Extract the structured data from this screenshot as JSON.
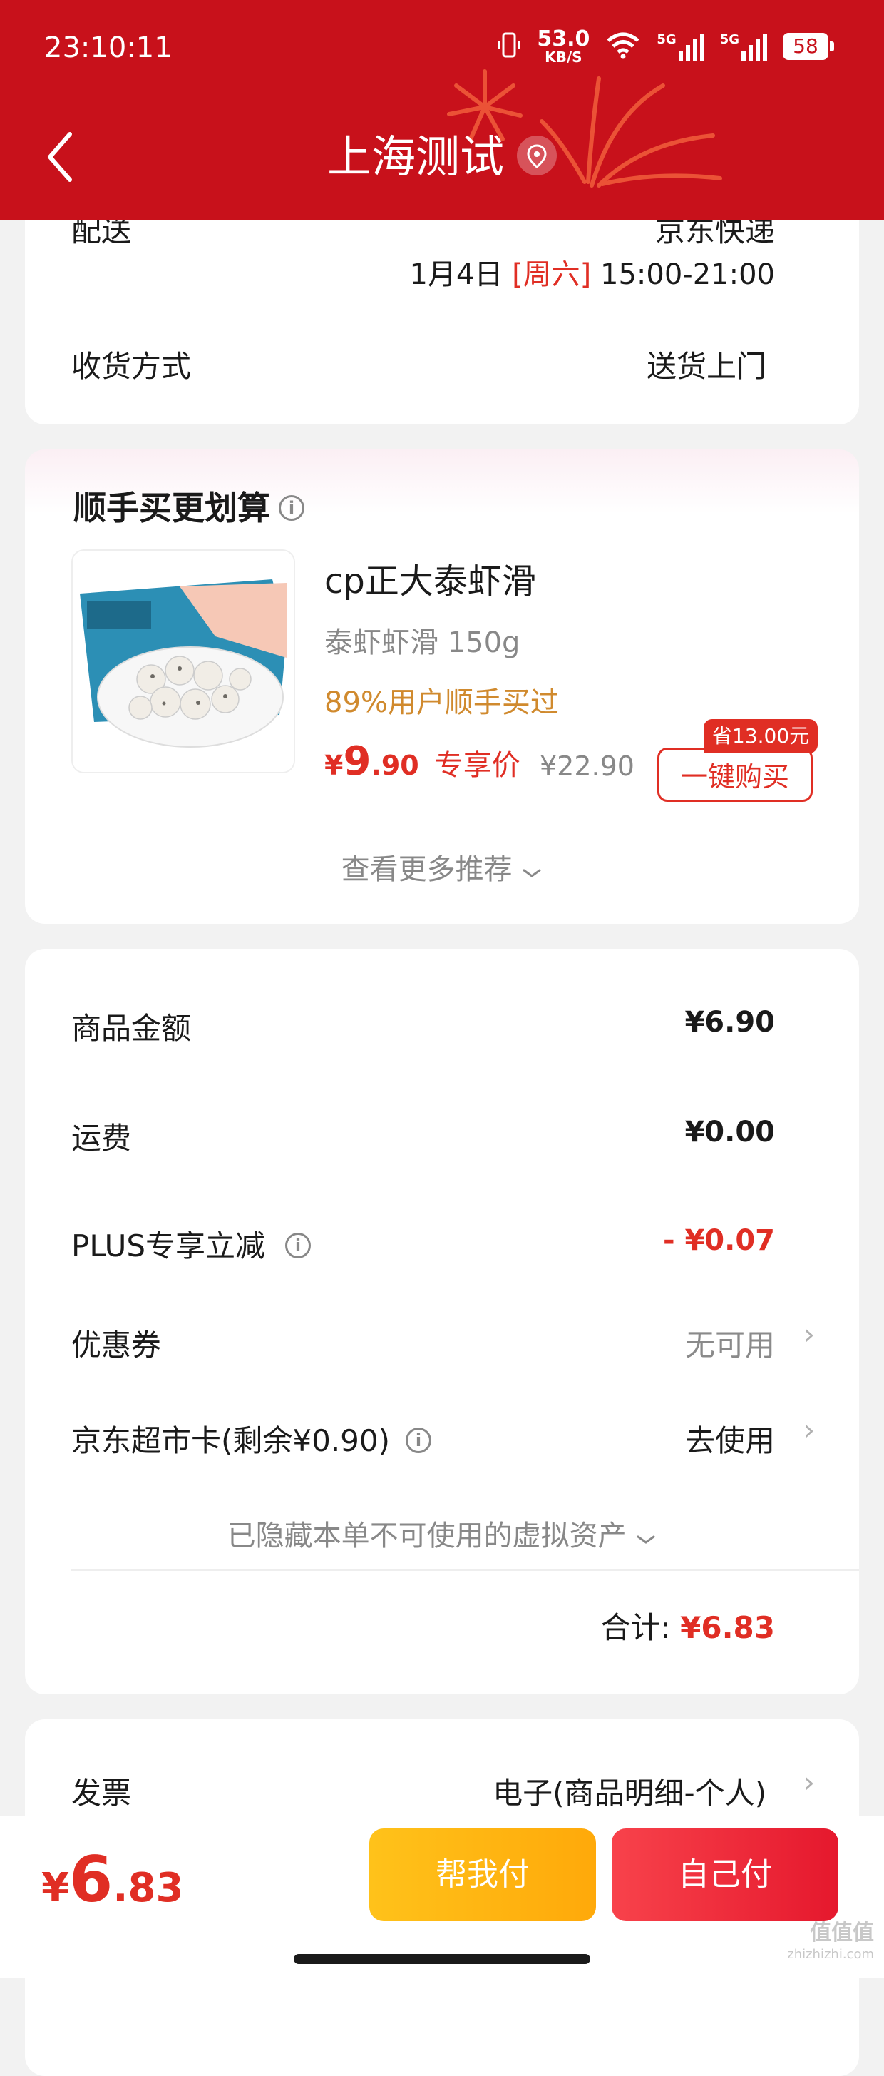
{
  "status_bar": {
    "time": "23:10:11",
    "net_speed_value": "53.0",
    "net_speed_unit": "KB/S",
    "signal_1": "5G",
    "signal_2": "5G",
    "battery": "58"
  },
  "header": {
    "title": "上海测试",
    "background_color": "#c8111b"
  },
  "delivery": {
    "label_partial": "配送",
    "value_partial": "京东快递",
    "date": "1月4日",
    "weekday": "[周六]",
    "time_slot": "15:00-21:00",
    "method_label": "收货方式",
    "method_value": "送货上门"
  },
  "recommend": {
    "title": "顺手买更划算",
    "product": {
      "name": "cp正大泰虾滑",
      "spec": "泰虾虾滑 150g",
      "tag": "89%用户顺手买过",
      "price_symbol": "¥",
      "price_int": "9",
      "price_dec": ".90",
      "price_label": "专享价",
      "original_price": "¥22.90",
      "save_badge": "省13.00元",
      "buy_button": "一键购买"
    },
    "more_label": "查看更多推荐"
  },
  "summary": {
    "rows": [
      {
        "label": "商品金额",
        "value": "¥6.90"
      },
      {
        "label": "运费",
        "value": "¥0.00"
      },
      {
        "label": "PLUS专享立减",
        "value": "- ¥0.07"
      },
      {
        "label": "优惠券",
        "value": "无可用"
      },
      {
        "label": "京东超市卡(剩余¥0.90)",
        "value": "去使用"
      }
    ],
    "hidden_assets": "已隐藏本单不可使用的虚拟资产",
    "total_label": "合计:",
    "total_value": "¥6.83"
  },
  "invoice": {
    "label": "发票",
    "value": "电子(商品明细-个人)"
  },
  "bottom_bar": {
    "total_symbol": "¥",
    "total_int": "6",
    "total_dec": ".83",
    "help_pay": "帮我付",
    "self_pay": "自己付"
  },
  "watermark": {
    "text": "值值值",
    "sub": "zhizhizhi.com"
  },
  "colors": {
    "accent_red": "#e02e24",
    "tag_orange": "#d08a2e",
    "help_pay_yellow": "#ffb60f",
    "self_pay_red": "#ee2838"
  }
}
